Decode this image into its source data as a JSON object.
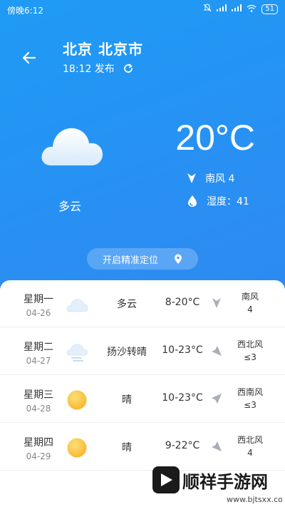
{
  "status": {
    "time": "傍晚6:12",
    "battery": "51"
  },
  "header": {
    "location": "北京 北京市",
    "publish_time": "18:12 发布"
  },
  "current": {
    "temperature": "20°C",
    "condition": "多云",
    "wind": "南风  4",
    "humidity": "湿度：41"
  },
  "locate_button": "开启精准定位",
  "forecast": [
    {
      "day": "星期一",
      "date": "04-26",
      "condition": "多云",
      "range": "8-20°C",
      "wind_dir": "南风",
      "wind_level": "4",
      "icon": "cloud-icon"
    },
    {
      "day": "星期二",
      "date": "04-27",
      "condition": "扬沙转晴",
      "range": "10-23°C",
      "wind_dir": "西北风",
      "wind_level": "≤3",
      "icon": "sandstorm-icon"
    },
    {
      "day": "星期三",
      "date": "04-28",
      "condition": "晴",
      "range": "10-23°C",
      "wind_dir": "西南风",
      "wind_level": "≤3",
      "icon": "sun-icon"
    },
    {
      "day": "星期四",
      "date": "04-29",
      "condition": "晴",
      "range": "9-22°C",
      "wind_dir": "西北风",
      "wind_level": "4",
      "icon": "sun-icon"
    }
  ],
  "watermark": {
    "text": "顺祥手游网",
    "url": "www.bjtsxx.com"
  },
  "colors": {
    "background": "#2A8FF2",
    "sun": "#F9C236",
    "arrow": "#A9AFB8"
  }
}
